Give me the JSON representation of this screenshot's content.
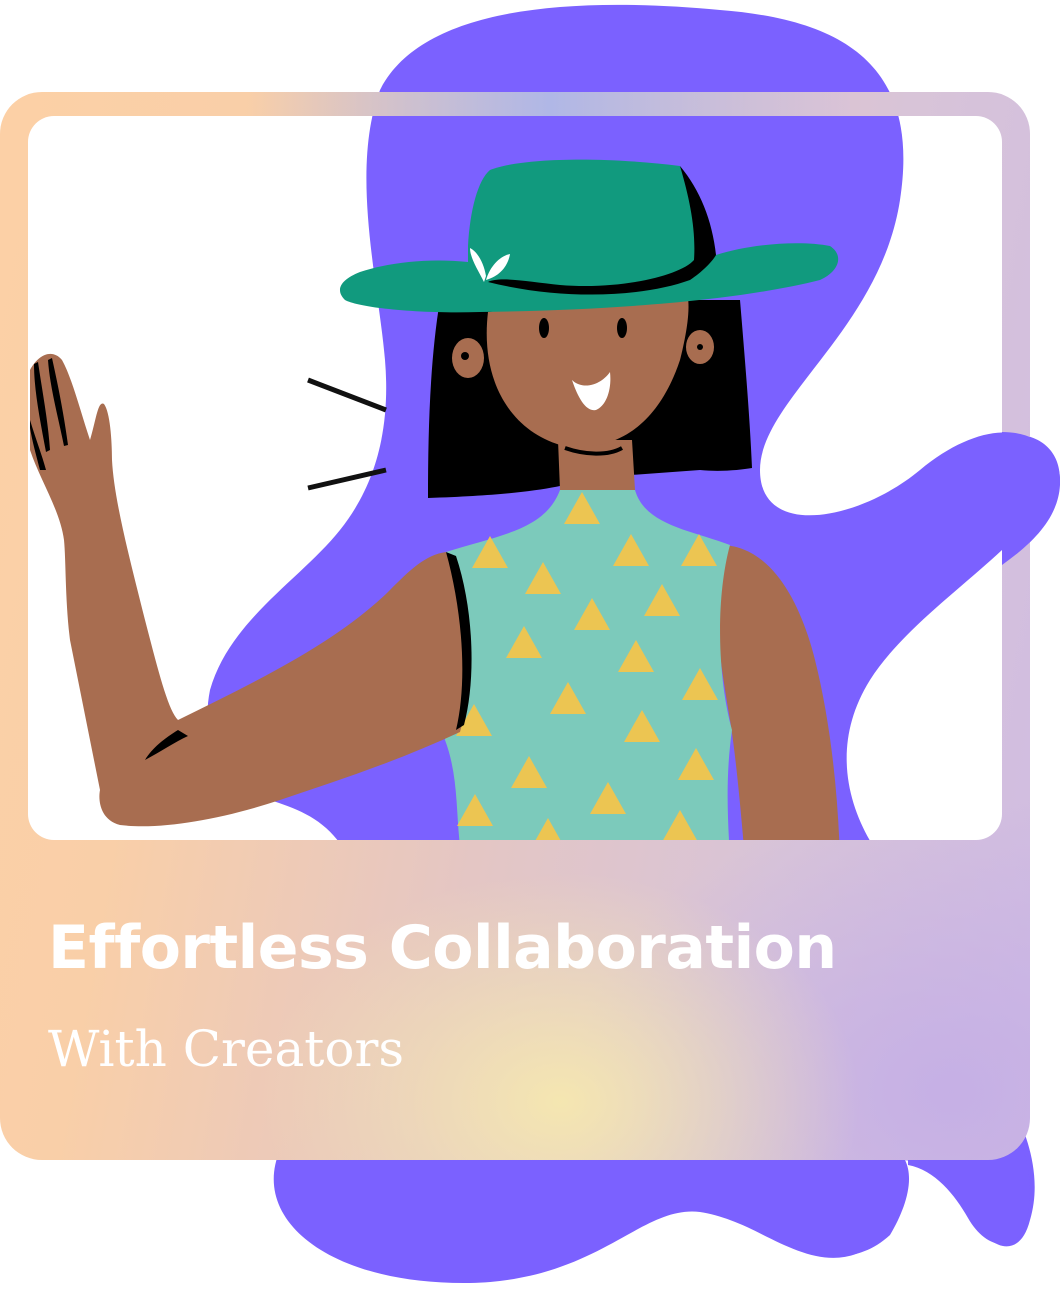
{
  "card": {
    "title": "Effortless Collaboration",
    "subtitle": "With Creators"
  },
  "colors": {
    "blob": "#7b61ff",
    "skin": "#a86d50",
    "hat": "#119a7e",
    "top": "#7ccabb",
    "triangles": "#ecc552",
    "hair": "#000000",
    "card_peach": "#fcd0a6",
    "card_lavender": "#d0bce2",
    "window": "#ffffff",
    "text": "#ffffff"
  },
  "illustration": {
    "subject": "waving-woman-with-green-hat",
    "pattern": "triangle-pattern"
  }
}
